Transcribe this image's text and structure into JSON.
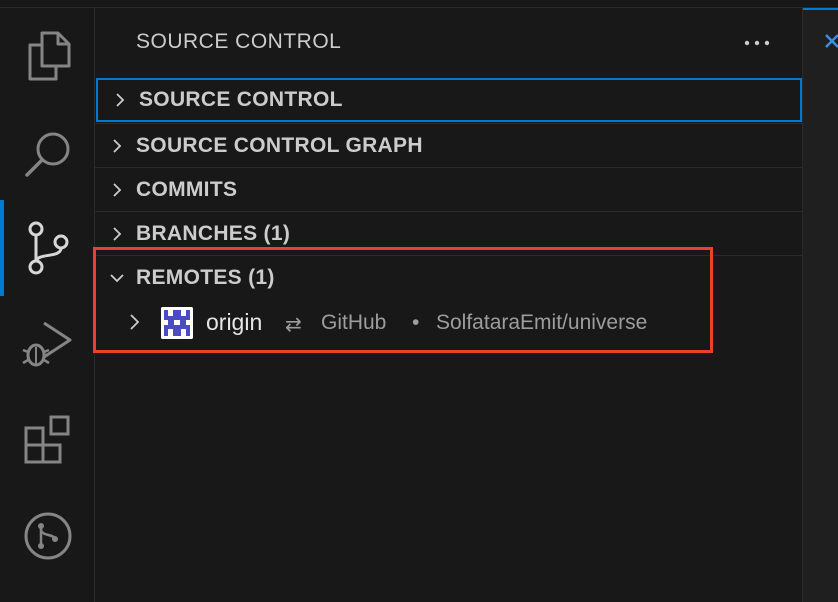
{
  "sidebar": {
    "title": "SOURCE CONTROL",
    "more_icon": "ellipsis-icon"
  },
  "activity_bar": {
    "items": [
      {
        "name": "explorer",
        "icon": "files-icon",
        "active": false
      },
      {
        "name": "search",
        "icon": "search-icon",
        "active": false
      },
      {
        "name": "source-control",
        "icon": "source-control-icon",
        "active": true
      },
      {
        "name": "run-and-debug",
        "icon": "run-debug-icon",
        "active": false
      },
      {
        "name": "extensions",
        "icon": "extensions-icon",
        "active": false
      },
      {
        "name": "git-graph",
        "icon": "git-pull-request-icon",
        "active": false
      }
    ]
  },
  "sections": [
    {
      "label": "SOURCE CONTROL",
      "expanded": false,
      "focused": true
    },
    {
      "label": "SOURCE CONTROL GRAPH",
      "expanded": false,
      "focused": false
    },
    {
      "label": "COMMITS",
      "expanded": false,
      "focused": false
    },
    {
      "label": "BRANCHES (1)",
      "expanded": false,
      "focused": false
    },
    {
      "label": "REMOTES (1)",
      "expanded": true,
      "focused": false
    }
  ],
  "remote": {
    "name": "origin",
    "arrows": "⇄",
    "provider": "GitHub",
    "separator": "•",
    "repo": "SolfataraEmit/universe"
  },
  "colors": {
    "accent": "#0078d4",
    "highlight": "#e8412c",
    "avatar": "#4b4bc4"
  }
}
